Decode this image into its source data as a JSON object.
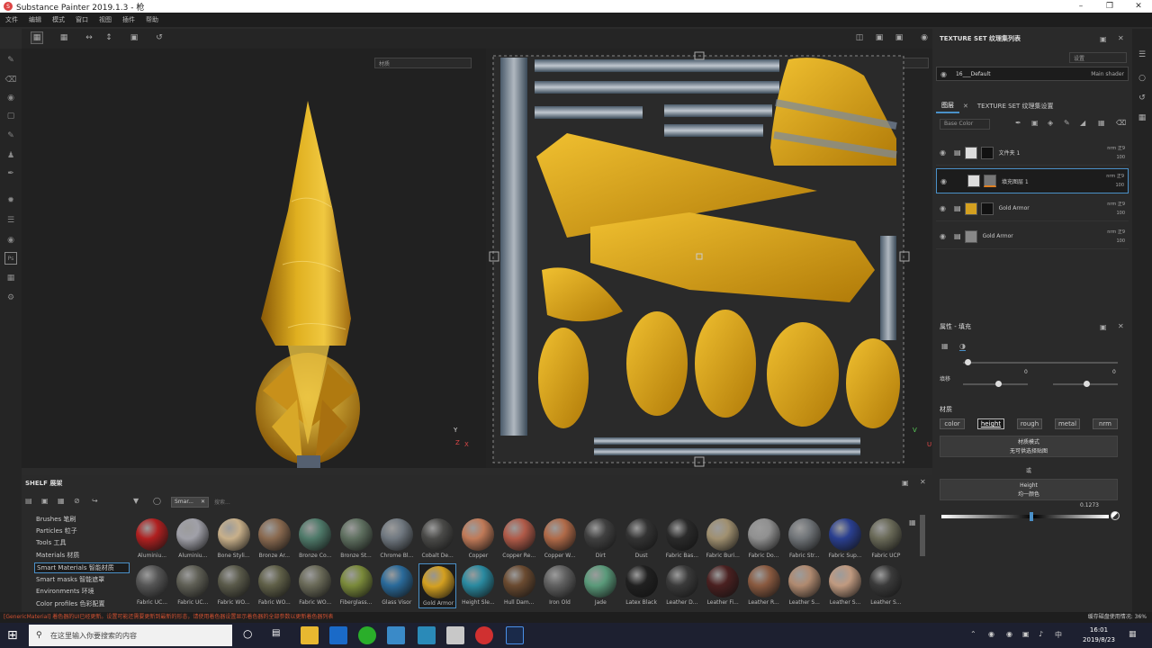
{
  "window": {
    "title": "Substance Painter 2019.1.3 - 枪",
    "app_icon": "S"
  },
  "window_controls": [
    "minimize-icon",
    "maximize-icon",
    "close-icon"
  ],
  "menu": [
    "文件",
    "编辑",
    "模式",
    "窗口",
    "视图",
    "插件",
    "帮助"
  ],
  "viewport": {
    "left_dropdown": "材质",
    "right_dropdown": "材质",
    "axis_3d": {
      "y": "Y",
      "z": "Z",
      "x": "X"
    },
    "axis_2d": {
      "v": "V",
      "u": "U"
    }
  },
  "texture_set_list": {
    "title": "TEXTURE SET 纹理集列表",
    "settings": "设置",
    "set_name": "16___Default",
    "shader": "Main shader"
  },
  "layers": {
    "tab1": "图层",
    "tab2": "TEXTURE SET 纹理集设置",
    "channel": "Base Color",
    "items": [
      {
        "name": "文件夹 1",
        "blend": "nrm 正9",
        "opacity": "100"
      },
      {
        "name": "填充图层 1",
        "blend": "nrm 正9",
        "opacity": "100"
      },
      {
        "name": "Gold Armor",
        "blend": "nrm 正9",
        "opacity": "100"
      },
      {
        "name": "Gold Armor",
        "blend": "nrm 正9",
        "opacity": "100"
      }
    ]
  },
  "properties": {
    "title": "属性 - 填充",
    "slider_label": "填移",
    "slider_val1": "0",
    "slider_val2": "0",
    "material_label": "材质",
    "channels": [
      "color",
      "height",
      "rough",
      "metal",
      "nrm"
    ],
    "active_channel": "height",
    "mode_title": "材质模式",
    "mode_sub": "无可供选择贴图",
    "or_label": "或",
    "height_title": "Height",
    "height_sub": "均一颜色",
    "height_value": "0.1273"
  },
  "shelf": {
    "title": "SHELF 展架",
    "filter_tag": "Smar...",
    "search_placeholder": "搜索...",
    "categories": [
      "Brushes 笔刷",
      "Particles 粒子",
      "Tools 工具",
      "Materials 材质",
      "Smart Materials 智能材质",
      "Smart masks 智能遮罩",
      "Environments 环境",
      "Color profiles 色彩配置"
    ],
    "active_category": "Smart Materials 智能材质",
    "materials_row1": [
      {
        "label": "Aluminiu...",
        "color": "#b02020"
      },
      {
        "label": "Aluminiu...",
        "color": "#a0a0a8"
      },
      {
        "label": "Bone Styli...",
        "color": "#c8b08a"
      },
      {
        "label": "Bronze Ar...",
        "color": "#8a6a50"
      },
      {
        "label": "Bronze Co...",
        "color": "#4f7a6a"
      },
      {
        "label": "Bronze St...",
        "color": "#5f7060"
      },
      {
        "label": "Chrome Bl...",
        "color": "#707880"
      },
      {
        "label": "Cobalt De...",
        "color": "#4a4a48"
      },
      {
        "label": "Copper",
        "color": "#c07a58"
      },
      {
        "label": "Copper Re...",
        "color": "#b05a48"
      },
      {
        "label": "Copper W...",
        "color": "#b06a48"
      },
      {
        "label": "Dirt",
        "color": "#404040"
      },
      {
        "label": "Dust",
        "color": "#333333"
      },
      {
        "label": "Fabric Bas...",
        "color": "#2a2a2a"
      },
      {
        "label": "Fabric Buri...",
        "color": "#a09070"
      },
      {
        "label": "Fabric Do...",
        "color": "#909090"
      },
      {
        "label": "Fabric Str...",
        "color": "#707478"
      },
      {
        "label": "Fabric Sup...",
        "color": "#2a3f90"
      },
      {
        "label": "Fabric UCP",
        "color": "#6a6a58"
      }
    ],
    "materials_row2": [
      {
        "label": "Fabric UC...",
        "color": "#555555"
      },
      {
        "label": "Fabric UC...",
        "color": "#5f5f55"
      },
      {
        "label": "Fabric WO...",
        "color": "#5a5a4a"
      },
      {
        "label": "Fabric WO...",
        "color": "#606048"
      },
      {
        "label": "Fabric WO...",
        "color": "#6a6a58"
      },
      {
        "label": "Fiberglass...",
        "color": "#7a8a3a"
      },
      {
        "label": "Glass Visor",
        "color": "#2a6a9a"
      },
      {
        "label": "Gold Armor",
        "color": "#d4a020"
      },
      {
        "label": "Height Sle...",
        "color": "#2a8aa0"
      },
      {
        "label": "Hull Dam...",
        "color": "#6a4a30"
      },
      {
        "label": "Iron Old",
        "color": "#606060"
      },
      {
        "label": "Jade",
        "color": "#5a9a7a"
      },
      {
        "label": "Latex Black",
        "color": "#202020"
      },
      {
        "label": "Leather D...",
        "color": "#3a3a3a"
      },
      {
        "label": "Leather Fi...",
        "color": "#4a2020"
      },
      {
        "label": "Leather R...",
        "color": "#8a5a40"
      },
      {
        "label": "Leather S...",
        "color": "#b08a70"
      },
      {
        "label": "Leather S...",
        "color": "#c09a80"
      },
      {
        "label": "Leather S...",
        "color": "#3a3a3a"
      }
    ],
    "selected_material": "Gold Armor"
  },
  "status": {
    "message": "[GenericMaterial] 着色器的UI已经更新。设置可能还需要更新到最新的形态，请使用着色器设置显示着色器的全部参数以更新着色器列表",
    "cache": "缓存磁盘使用情况: 36%"
  },
  "taskbar": {
    "search_placeholder": "在这里输入你要搜索的内容",
    "time": "16:01",
    "date": "2019/8/23"
  }
}
